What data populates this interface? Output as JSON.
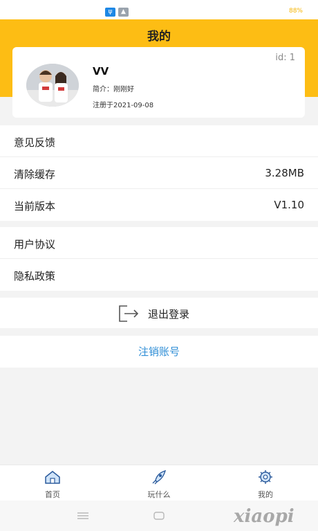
{
  "status_bar": {
    "icons": [
      "usb-debug-icon",
      "notification-icon"
    ],
    "battery_text": "88%"
  },
  "header": {
    "title": "我的",
    "background": "#fdbd14"
  },
  "profile": {
    "id_text": "id: 1",
    "username": "VV",
    "intro": "简介：刚刚好",
    "registered": "注册于2021-09-08"
  },
  "settings_group": [
    {
      "label": "意见反馈",
      "value": ""
    },
    {
      "label": "清除缓存",
      "value": "3.28MB"
    },
    {
      "label": "当前版本",
      "value": "V1.10"
    }
  ],
  "legal_group": [
    {
      "label": "用户协议"
    },
    {
      "label": "隐私政策"
    }
  ],
  "logout": {
    "label": "退出登录"
  },
  "cancel_account": {
    "label": "注销账号",
    "color": "#2f8ed6"
  },
  "tabbar": {
    "items": [
      {
        "label": "首页",
        "icon": "home-icon"
      },
      {
        "label": "玩什么",
        "icon": "rocket-icon"
      },
      {
        "label": "我的",
        "icon": "gear-icon"
      }
    ],
    "icon_color": "#2a5a9c"
  },
  "watermark": "xiaopi"
}
